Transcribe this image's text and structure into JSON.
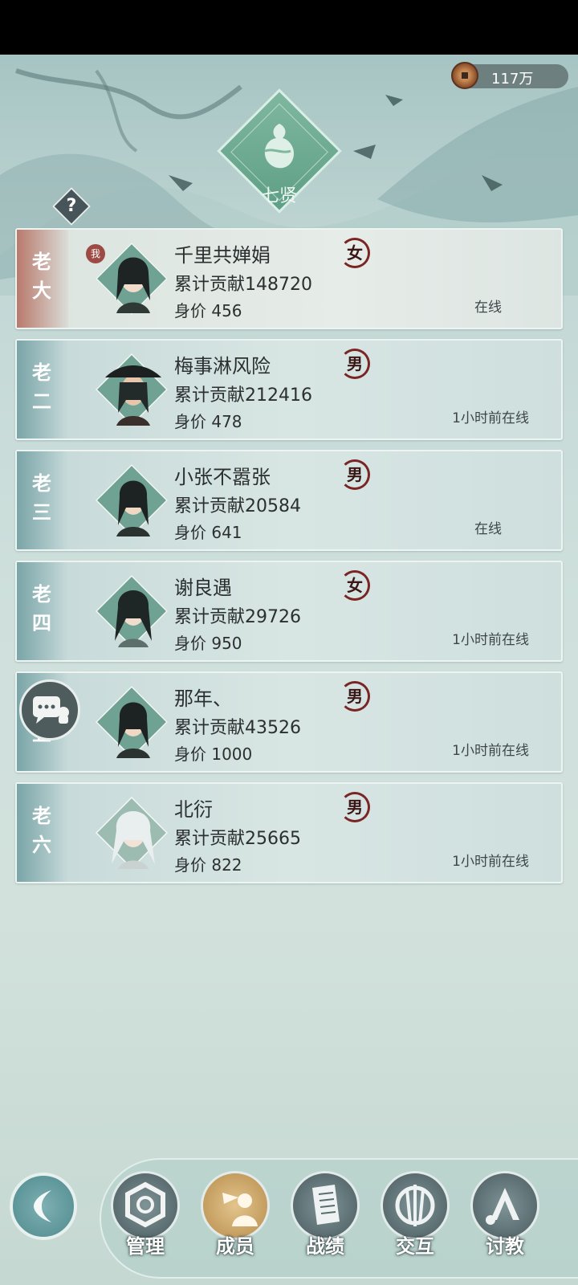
{
  "header": {
    "currency_amount": "117万",
    "currency_icon": "copper-coin-icon",
    "guild_title": "七贤",
    "help_label": "?"
  },
  "members": [
    {
      "rank": "老大",
      "name": "千里共婵娟",
      "contribution": "累计贡献148720",
      "worth": "身价 456",
      "gender": "女",
      "status": "在线",
      "is_me": true,
      "me_tag": "我"
    },
    {
      "rank": "老二",
      "name": "梅事淋风险",
      "contribution": "累计贡献212416",
      "worth": "身价 478",
      "gender": "男",
      "status": "1小时前在线"
    },
    {
      "rank": "老三",
      "name": "小张不嚣张",
      "contribution": "累计贡献20584",
      "worth": "身价 641",
      "gender": "男",
      "status": "在线"
    },
    {
      "rank": "老四",
      "name": "谢良遇",
      "contribution": "累计贡献29726",
      "worth": "身价 950",
      "gender": "女",
      "status": "1小时前在线"
    },
    {
      "rank": "老五",
      "name": "那年、",
      "contribution": "累计贡献43526",
      "worth": "身价 1000",
      "gender": "男",
      "status": "1小时前在线"
    },
    {
      "rank": "老六",
      "name": "北衍",
      "contribution": "累计贡献25665",
      "worth": "身价 822",
      "gender": "男",
      "status": "1小时前在线"
    }
  ],
  "nav": [
    {
      "label": "管理",
      "icon": "manage-icon"
    },
    {
      "label": "成员",
      "icon": "members-icon",
      "active": true
    },
    {
      "label": "战绩",
      "icon": "record-scroll-icon"
    },
    {
      "label": "交互",
      "icon": "interact-swords-icon"
    },
    {
      "label": "讨教",
      "icon": "duel-icon"
    }
  ],
  "colors": {
    "accent": "#7b2424",
    "self_rank": "#b97a6d",
    "rank": "#7aa5a8"
  }
}
